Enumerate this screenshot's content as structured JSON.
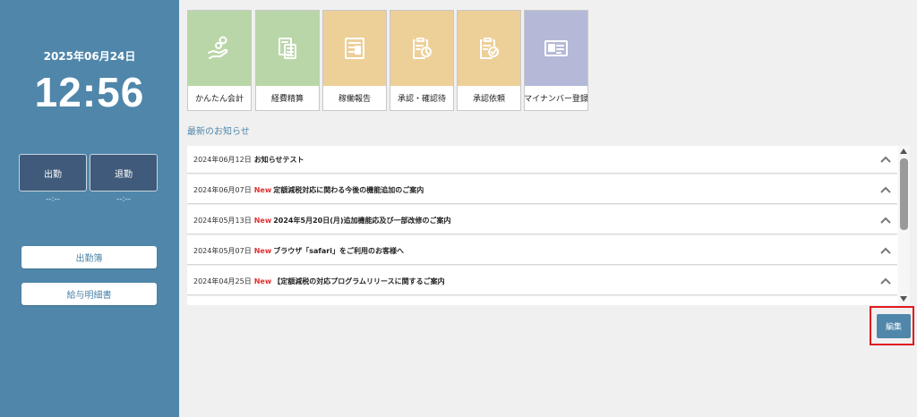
{
  "sidebar": {
    "date": "2025年06月24日",
    "time": "12:56",
    "clock_in_label": "出勤",
    "clock_out_label": "退勤",
    "clock_in_time": "--:--",
    "clock_out_time": "--:--",
    "links": [
      "出勤簿",
      "給与明細書"
    ]
  },
  "tiles": [
    {
      "label": "かんたん会計",
      "icon": "hand-coins-icon",
      "color": "#b9d6a8"
    },
    {
      "label": "経費精算",
      "icon": "calculator-document-icon",
      "color": "#b9d6a8"
    },
    {
      "label": "稼働報告",
      "icon": "report-document-icon",
      "color": "#edcf98"
    },
    {
      "label": "承認・確認待",
      "icon": "approval-pending-icon",
      "color": "#edcf98"
    },
    {
      "label": "承認依頼",
      "icon": "approval-request-icon",
      "color": "#edcf98"
    },
    {
      "label": "マイナンバー登録",
      "icon": "id-card-icon",
      "color": "#b4b9d8"
    }
  ],
  "news": {
    "section_title": "最新のお知らせ",
    "new_label": "New",
    "items": [
      {
        "date": "2024年06月12日",
        "is_new": false,
        "title": "お知らせテスト"
      },
      {
        "date": "2024年06月07日",
        "is_new": true,
        "title": "定額減税対応に関わる今後の機能追加のご案内"
      },
      {
        "date": "2024年05月13日",
        "is_new": true,
        "title": "2024年5月20日(月)追加機能応及び一部改修のご案内"
      },
      {
        "date": "2024年05月07日",
        "is_new": true,
        "title": "ブラウザ「safari」をご利用のお客様へ"
      },
      {
        "date": "2024年04月25日",
        "is_new": true,
        "title": "【定額減税の対応プログラムリリースに関するご案内"
      }
    ]
  },
  "edit_label": "編集",
  "colors": {
    "sidebar": "#4f86aa",
    "new": "#e03131",
    "highlight": "#e0191e"
  }
}
